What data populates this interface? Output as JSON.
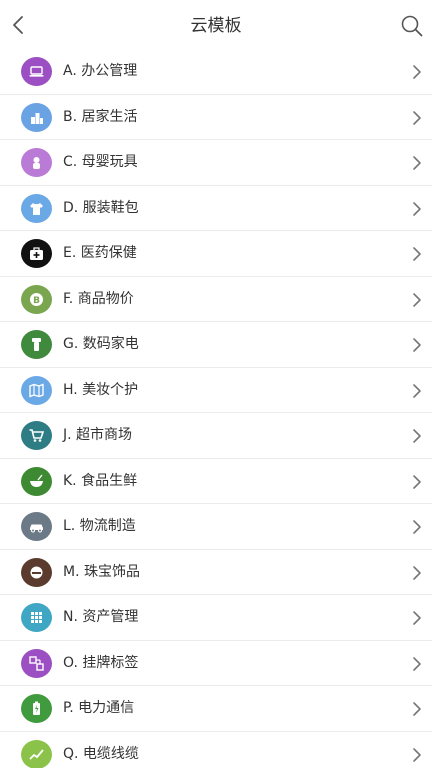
{
  "header": {
    "title": "云模板",
    "back_icon": "chevron-left-icon",
    "search_icon": "search-icon"
  },
  "categories": [
    {
      "label": "A. 办公管理",
      "color": "#9b4fc2",
      "icon": "laptop-icon"
    },
    {
      "label": "B. 居家生活",
      "color": "#69a3e3",
      "icon": "buildings-icon"
    },
    {
      "label": "C. 母婴玩具",
      "color": "#b97bd6",
      "icon": "baby-icon"
    },
    {
      "label": "D. 服装鞋包",
      "color": "#6aa8e6",
      "icon": "tshirt-icon"
    },
    {
      "label": "E. 医药保健",
      "color": "#111111",
      "icon": "medical-kit-icon"
    },
    {
      "label": "F. 商品物价",
      "color": "#79a64e",
      "icon": "bitcoin-icon"
    },
    {
      "label": "G. 数码家电",
      "color": "#3f8a3d",
      "icon": "flashlight-icon"
    },
    {
      "label": "H. 美妆个护",
      "color": "#6aa8e6",
      "icon": "map-icon"
    },
    {
      "label": "J. 超市商场",
      "color": "#2f7d84",
      "icon": "cart-icon"
    },
    {
      "label": "K. 食品生鲜",
      "color": "#3d8a32",
      "icon": "bowl-icon"
    },
    {
      "label": "L. 物流制造",
      "color": "#6b7a86",
      "icon": "car-icon"
    },
    {
      "label": "M. 珠宝饰品",
      "color": "#5a3b2e",
      "icon": "jewel-icon"
    },
    {
      "label": "N. 资产管理",
      "color": "#3fa6c3",
      "icon": "grid-icon"
    },
    {
      "label": "O. 挂牌标签",
      "color": "#9b4fc2",
      "icon": "tag-icon"
    },
    {
      "label": "P. 电力通信",
      "color": "#3f9b3d",
      "icon": "battery-icon"
    },
    {
      "label": "Q. 电缆线缆",
      "color": "#8bc34a",
      "icon": "trend-icon"
    }
  ]
}
